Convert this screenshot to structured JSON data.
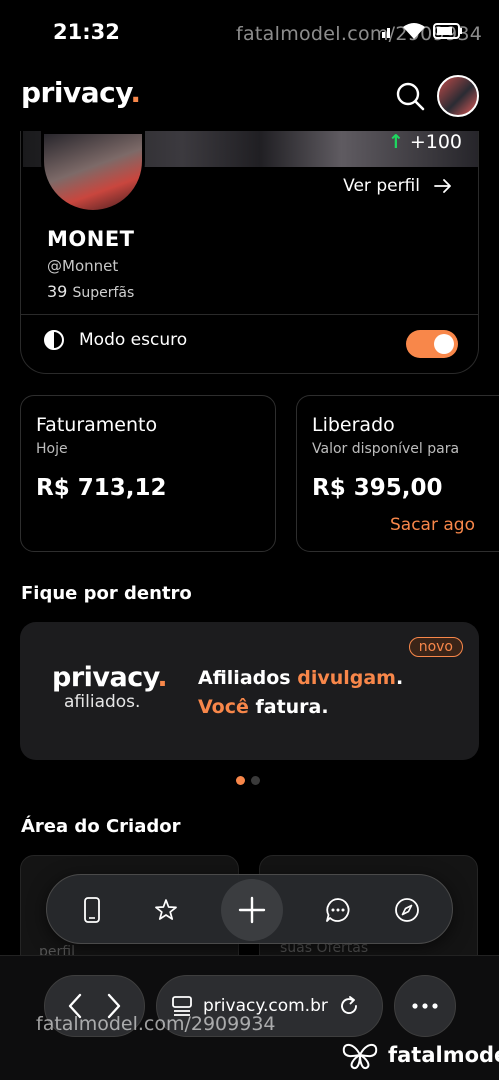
{
  "status": {
    "time": "21:32",
    "watermark": "fatalmodel.com/2909934"
  },
  "appbar": {
    "logo": "privacy",
    "logo_dot": "."
  },
  "profile": {
    "superfan_delta": "+100",
    "view_profile": "Ver perfil",
    "name": "MONET",
    "handle": "@Monnet",
    "superfans_count": "39",
    "superfans_label": "Superfãs",
    "dark_mode_label": "Modo escuro",
    "dark_mode_on": true
  },
  "stats": [
    {
      "title": "Faturamento",
      "subtitle": "Hoje",
      "value": "R$ 713,12"
    },
    {
      "title": "Liberado",
      "subtitle": "Valor disponível para",
      "value": "R$ 395,00",
      "action": "Sacar ago"
    }
  ],
  "sections": {
    "news": "Fique por dentro",
    "creator": "Área do Criador"
  },
  "banner": {
    "logo": "privacy",
    "logo_dot": ".",
    "logo_sub": "afiliados.",
    "line1_a": "Afiliados ",
    "line1_b": "divulgam",
    "line1_c": ".",
    "line2_a": "Você",
    "line2_b": " fatura.",
    "badge": "novo"
  },
  "creator_cards": [
    {
      "label": "perfil"
    },
    {
      "label": "suas Ofertas"
    }
  ],
  "browser": {
    "url": "privacy.com.br"
  },
  "footer": {
    "watermark": "fatalmodel.com/2909934",
    "brand": "fatalmodel"
  },
  "colors": {
    "accent": "#f8874a",
    "positive": "#1ed760",
    "background": "#000000"
  }
}
